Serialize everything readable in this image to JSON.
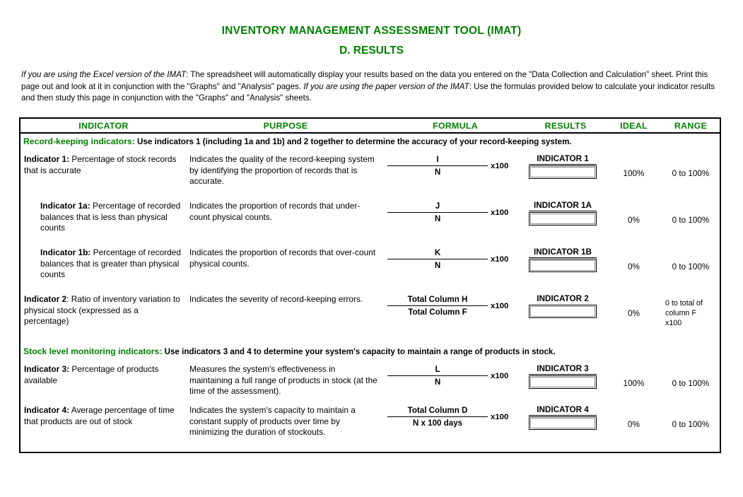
{
  "title": {
    "main": "INVENTORY MANAGEMENT ASSESSMENT TOOL (IMAT)",
    "sub": "D. RESULTS"
  },
  "intro": {
    "lead_italic": "If you are using the Excel version of the IMAT",
    "part1": ": The spreadsheet will automatically display your results based on the data you entered on the \"Data Collection and Calculation\" sheet. Print this page out and look at it in conjunction with the \"Graphs\" and \"Analysis\" pages. ",
    "mid_italic": "If you are using the paper version of the IMAT",
    "part2": ": Use the formulas provided below to calculate your indicator results and then study this page in conjunction with the \"Graphs\" and \"Analysis\" sheets."
  },
  "table": {
    "headers": {
      "indicator": "INDICATOR",
      "purpose": "PURPOSE",
      "formula": "FORMULA",
      "results": "RESULTS",
      "ideal": "IDEAL",
      "range": "RANGE"
    },
    "sections": [
      {
        "band_label": "Record-keeping indicators:",
        "band_text": " Use indicators 1 (including 1a and 1b) and 2 together to determine the accuracy of your record-keeping system.",
        "rows": [
          {
            "indicator_bold": "Indicator 1:",
            "indicator_text": " Percentage of stock records that is accurate",
            "purpose": "Indicates the quality of the record-keeping system by identifying the proportion of records that is accurate.",
            "numerator": "I",
            "denominator": "N",
            "multiplier": "x100",
            "result_label": "INDICATOR 1",
            "result_value": "",
            "ideal": "100%",
            "range": "0 to 100%"
          },
          {
            "indicator_bold": "Indicator 1a:",
            "indicator_text": "  Percentage of recorded balances that is less than physical counts",
            "purpose": "Indicates the proportion of records that under-count physical counts.",
            "numerator": "J",
            "denominator": "N",
            "multiplier": "x100",
            "result_label": "INDICATOR 1A",
            "result_value": "",
            "ideal": "0%",
            "range": "0 to 100%"
          },
          {
            "indicator_bold": "Indicator 1b:",
            "indicator_text": " Percentage of recorded balances that is greater than physical counts",
            "purpose": "Indicates the proportion of records that over-count physical counts.",
            "numerator": "K",
            "denominator": "N",
            "multiplier": "x100",
            "result_label": "INDICATOR 1B",
            "result_value": "",
            "ideal": "0%",
            "range": "0 to 100%"
          },
          {
            "indicator_bold": "Indicator 2",
            "indicator_text": ": Ratio of inventory variation to physical stock (expressed as a percentage)",
            "purpose": "Indicates the severity of record-keeping errors.",
            "numerator": "Total Column H",
            "denominator": "Total Column F",
            "multiplier": "x100",
            "result_label": "INDICATOR 2",
            "result_value": "",
            "ideal": "0%",
            "range": "0 to total of column F x100"
          }
        ]
      },
      {
        "band_label": "Stock level monitoring indicators:",
        "band_text": " Use indicators 3 and 4 to determine your system's capacity to maintain a range of products in stock.",
        "rows": [
          {
            "indicator_bold": "Indicator 3:",
            "indicator_text": " Percentage of products available",
            "purpose": "Measures the system's effectiveness in maintaining a full range of products in stock (at the time of the assessment).",
            "numerator": "L",
            "denominator": "N",
            "multiplier": "x100",
            "result_label": "INDICATOR 3",
            "result_value": "",
            "ideal": "100%",
            "range": "0 to 100%"
          },
          {
            "indicator_bold": "Indicator 4:",
            "indicator_text": " Average percentage of time that products are out of stock",
            "purpose": "Indicates the system's capacity to maintain a constant supply of products over time by minimizing the duration of stockouts.",
            "numerator": "Total Column D",
            "denominator": "N x 100 days",
            "multiplier": "x100",
            "result_label": "INDICATOR 4",
            "result_value": "",
            "ideal": "0%",
            "range": "0 to 100%"
          }
        ]
      }
    ]
  },
  "colors": {
    "accent_green": "#008000",
    "text_black": "#000000",
    "background": "#ffffff"
  }
}
